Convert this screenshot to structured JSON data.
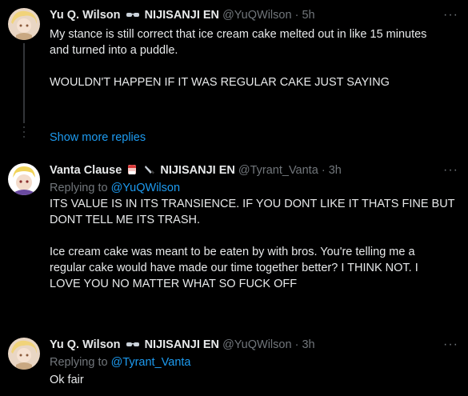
{
  "tweets": [
    {
      "name": "Yu Q. Wilson",
      "org": "NIJISANJI EN",
      "handle": "@YuQWilson",
      "time": "5h",
      "body": "My stance is still correct that ice cream cake melted out in like 15 minutes\nand turned into a puddle.\n\nWOULDN'T HAPPEN IF IT WAS REGULAR CAKE JUST SAYING",
      "more": "···"
    },
    {
      "name": "Vanta Clause",
      "org": "NIJISANJI EN",
      "handle": "@Tyrant_Vanta",
      "time": "3h",
      "replying_prefix": "Replying to",
      "replying_to": "@YuQWilson",
      "body": "ITS VALUE IS IN ITS TRANSIENCE. IF YOU DONT LIKE IT THATS FINE BUT\nDONT TELL ME ITS TRASH.\n\nIce cream cake was meant to be eaten by with bros. You're telling me a\nregular cake would have made our time together better? I THINK NOT. I\nLOVE YOU NO MATTER WHAT SO FUCK OFF",
      "more": "···"
    },
    {
      "name": "Yu Q. Wilson",
      "org": "NIJISANJI EN",
      "handle": "@YuQWilson",
      "time": "3h",
      "replying_prefix": "Replying to",
      "replying_to": "@Tyrant_Vanta",
      "body": "Ok fair",
      "more": "···"
    }
  ],
  "separator": "·",
  "show_more_replies": "Show more replies",
  "colors": {
    "background": "#000000",
    "text": "#e7e9ea",
    "muted": "#71767b",
    "link": "#1d9bf0"
  }
}
